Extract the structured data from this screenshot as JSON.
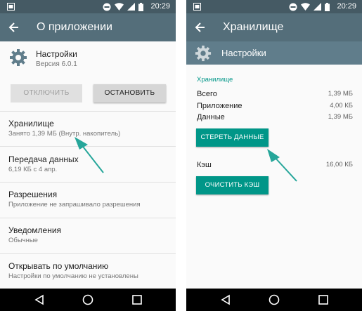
{
  "left": {
    "status": {
      "time": "20:29"
    },
    "toolbar": {
      "title": "О приложении"
    },
    "app": {
      "name": "Настройки",
      "version": "Версия 6.0.1",
      "icon": "gear-icon"
    },
    "buttons": {
      "disable": "ОТКЛЮЧИТЬ",
      "stop": "ОСТАНОВИТЬ"
    },
    "items": [
      {
        "title": "Хранилище",
        "subtitle": "Занято 1,39  МБ (Внутр. накопитель)"
      },
      {
        "title": "Передача данных",
        "subtitle": "6,19  КБ с 4 апр."
      },
      {
        "title": "Разрешения",
        "subtitle": "Приложение не запрашивало разрешения"
      },
      {
        "title": "Уведомления",
        "subtitle": "Обычные"
      },
      {
        "title": "Открывать по умолчанию",
        "subtitle": "Настройки по умолчанию не установлены"
      }
    ]
  },
  "right": {
    "status": {
      "time": "20:29"
    },
    "toolbar": {
      "title": "Хранилище"
    },
    "app": {
      "name": "Настройки",
      "icon": "gear-icon"
    },
    "section_title": "Хранилище",
    "rows": [
      {
        "label": "Всего",
        "value": "1,39  МБ"
      },
      {
        "label": "Приложение",
        "value": "4,00  КБ"
      },
      {
        "label": "Данные",
        "value": "1,39  МБ"
      }
    ],
    "clear_data_label": "СТЕРЕТЬ ДАННЫЕ",
    "cache": {
      "label": "Кэш",
      "value": "16,00  КБ"
    },
    "clear_cache_label": "ОЧИСТИТЬ КЭШ"
  },
  "colors": {
    "statusbar": "#455a64",
    "toolbar": "#546e7a",
    "app_header": "#607d8b",
    "accent": "#009688",
    "annotation_arrow": "#26a69a"
  }
}
